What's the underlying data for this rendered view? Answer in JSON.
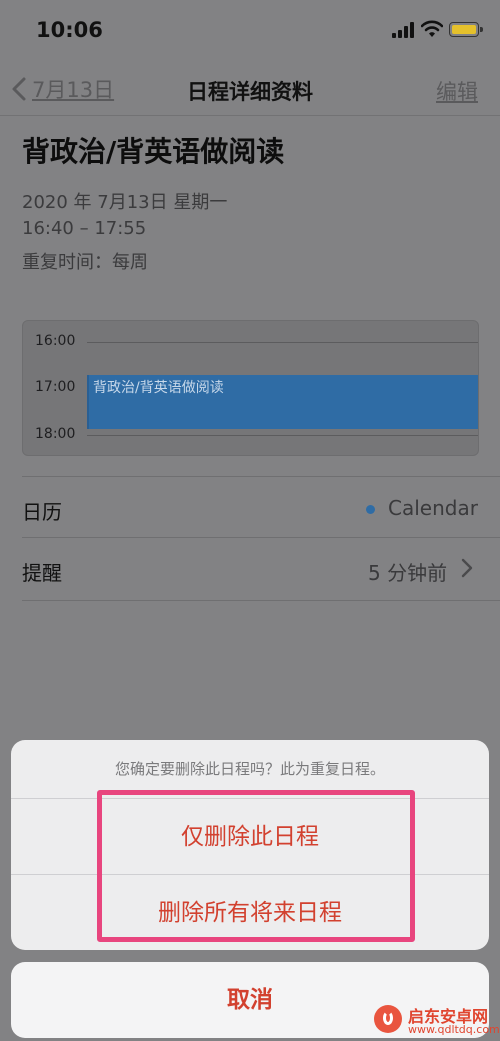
{
  "status_bar": {
    "time": "10:06"
  },
  "nav": {
    "back_label": "7月13日",
    "title": "日程详细资料",
    "edit_label": "编辑"
  },
  "event": {
    "title": "背政治/背英语做阅读",
    "date": "2020 年 7月13日 星期一",
    "time_range": "16:40 – 17:55",
    "repeat": "重复时间：每周"
  },
  "timeline": {
    "hours": [
      "16:00",
      "17:00",
      "18:00"
    ],
    "event_label": "背政治/背英语做阅读"
  },
  "details": {
    "calendar_label": "日历",
    "calendar_value": "Calendar",
    "reminder_label": "提醒",
    "reminder_value": "5 分钟前"
  },
  "action_sheet": {
    "message": "您确定要删除此日程吗？此为重复日程。",
    "delete_this": "仅删除此日程",
    "delete_future": "删除所有将来日程",
    "cancel": "取消"
  },
  "colors": {
    "accent_red": "#d2412f",
    "calendar_blue": "#2f6ca5",
    "highlight_pink": "#e8457e"
  },
  "watermark": {
    "name": "启东安卓网",
    "url": "www.qdltdq.com"
  }
}
